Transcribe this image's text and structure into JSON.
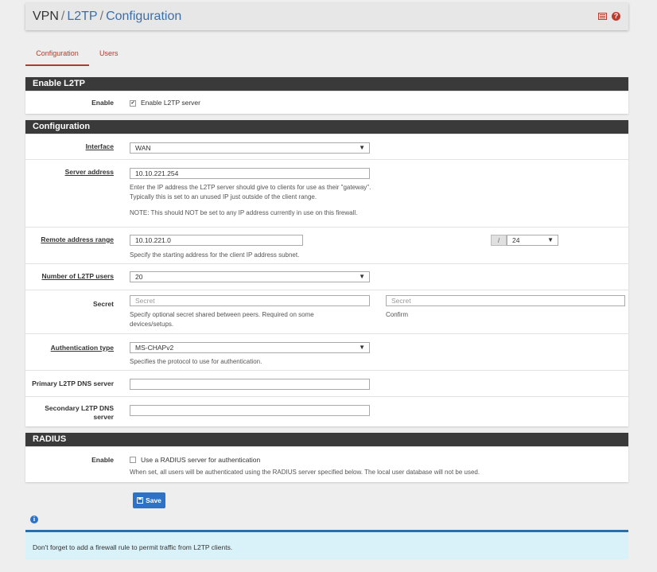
{
  "breadcrumb": [
    "VPN",
    "L2TP",
    "Configuration"
  ],
  "header_icons": [
    "list-icon",
    "help-icon"
  ],
  "tabs": [
    {
      "label": "Configuration",
      "active": true
    },
    {
      "label": "Users",
      "active": false
    }
  ],
  "enable_section": {
    "title": "Enable L2TP",
    "enable_label": "Enable",
    "enable_checkbox_label": "Enable L2TP server",
    "enable_checked": true
  },
  "config_section": {
    "title": "Configuration",
    "interface": {
      "label": "Interface",
      "value": "WAN"
    },
    "server_address": {
      "label": "Server address",
      "value": "10.10.221.254",
      "help1": "Enter the IP address the L2TP server should give to clients for use as their \"gateway\".",
      "help2": "Typically this is set to an unused IP just outside of the client range.",
      "note": "NOTE: This should NOT be set to any IP address currently in use on this firewall."
    },
    "remote_range": {
      "label": "Remote address range",
      "value": "10.10.221.0",
      "slash": "/",
      "mask": "24",
      "help": "Specify the starting address for the client IP address subnet."
    },
    "num_users": {
      "label": "Number of L2TP users",
      "value": "20"
    },
    "secret": {
      "label": "Secret",
      "placeholder": "Secret",
      "confirm_placeholder": "Secret",
      "help1": "Specify optional secret shared between peers. Required on some",
      "help2": "devices/setups.",
      "confirm_label": "Confirm"
    },
    "auth_type": {
      "label": "Authentication type",
      "value": "MS-CHAPv2",
      "help": "Specifies the protocol to use for authentication."
    },
    "primary_dns": {
      "label": "Primary L2TP DNS server",
      "value": ""
    },
    "secondary_dns": {
      "label_line1": "Secondary L2TP DNS",
      "label_line2": "server",
      "value": ""
    }
  },
  "radius_section": {
    "title": "RADIUS",
    "enable_label": "Enable",
    "checkbox_label": "Use a RADIUS server for authentication",
    "checked": false,
    "help": "When set, all users will be authenticated using the RADIUS server specified below. The local user database will not be used."
  },
  "save_label": "Save",
  "alert_text": "Don't forget to add a firewall rule to permit traffic from L2TP clients.",
  "colors": {
    "accent_red": "#b23b2b",
    "link_blue": "#3c6fa6",
    "button_blue": "#2c72c7",
    "panel_dark": "#3a3a3a",
    "alert_bg": "#d9f2f9"
  }
}
